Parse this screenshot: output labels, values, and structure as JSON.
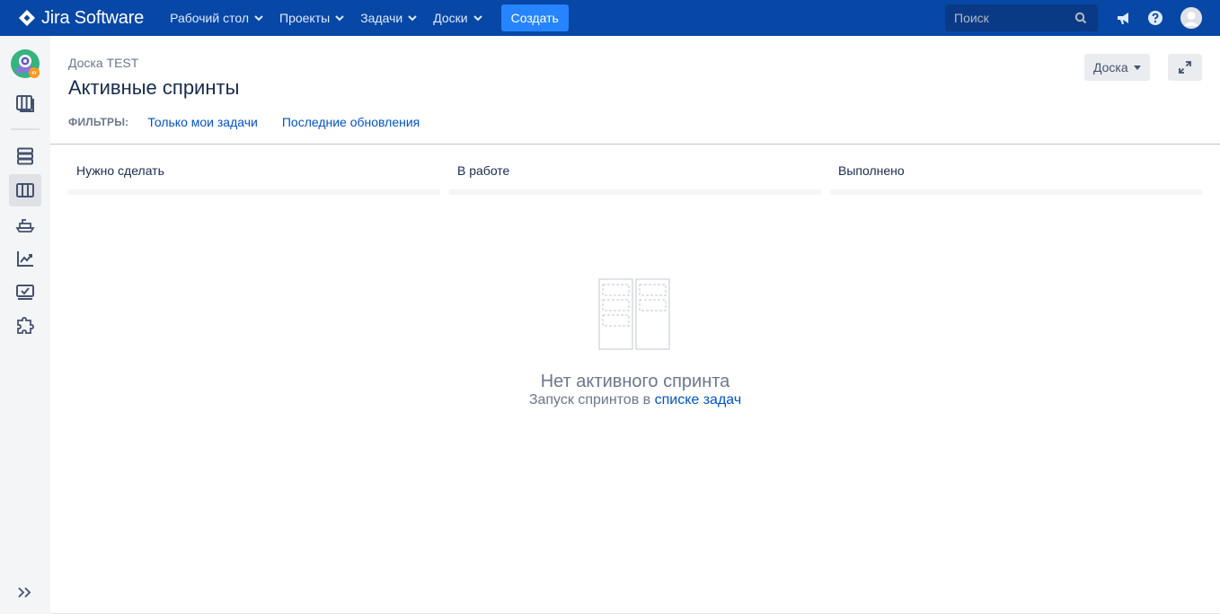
{
  "topnav": {
    "logo_text": "Jira Software",
    "menu": [
      {
        "label": "Рабочий стол"
      },
      {
        "label": "Проекты"
      },
      {
        "label": "Задачи"
      },
      {
        "label": "Доски"
      }
    ],
    "create_label": "Создать",
    "search_placeholder": "Поиск",
    "icons": [
      "notifications-megaphone-icon",
      "help-icon",
      "user-avatar"
    ]
  },
  "sidebar": {
    "items": [
      {
        "icon": "project-avatar-icon"
      },
      {
        "icon": "board-switcher-icon"
      },
      {
        "icon": "backlog-icon"
      },
      {
        "icon": "active-sprints-icon",
        "active": true
      },
      {
        "icon": "releases-icon"
      },
      {
        "icon": "reports-icon"
      },
      {
        "icon": "issues-icon"
      },
      {
        "icon": "add-ons-icon"
      },
      {
        "icon": "expand-sidebar-icon"
      }
    ]
  },
  "main": {
    "breadcrumb": "Доска TEST",
    "title": "Активные спринты",
    "filters_label": "ФИЛЬТРЫ:",
    "filters": [
      "Только мои задачи",
      "Последние обновления"
    ],
    "board_button": "Доска",
    "columns": [
      "Нужно сделать",
      "В работе",
      "Выполнено"
    ],
    "empty_title": "Нет активного спринта",
    "empty_sub_prefix": "Запуск спринтов в ",
    "empty_sub_link": "списке задач"
  },
  "colors": {
    "nav_bg": "#0747a6",
    "create_bg": "#2684ff",
    "link": "#0052cc",
    "sidebar_bg": "#f4f5f7"
  }
}
